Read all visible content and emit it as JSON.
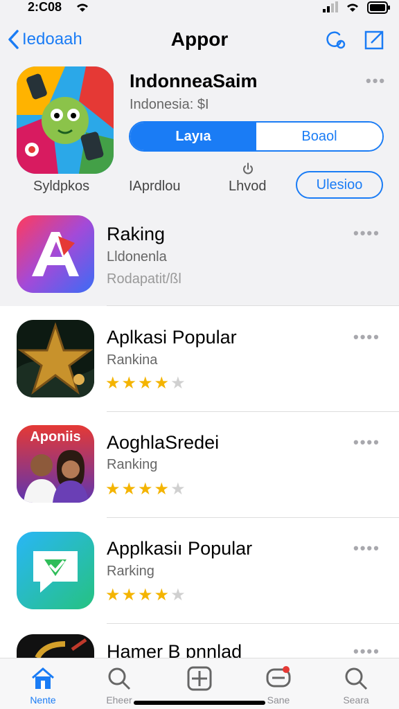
{
  "status": {
    "time": "2:C08"
  },
  "nav": {
    "back_label": "Iedoaah",
    "title": "Appor"
  },
  "featured": {
    "name": "IndonneaSaim",
    "subtitle": "Indonesia: $I",
    "seg_left": "Layıa",
    "seg_right": "Boaol",
    "meta": [
      "Syldpkos",
      "IAprdlou",
      "Lhvod"
    ],
    "update_label": "Ulesioo"
  },
  "apps": [
    {
      "name": "Raking",
      "sub": "Lldonenla",
      "sub2": "Rodapatit/ßl",
      "rating": null
    },
    {
      "name": "Aplkasi Popular",
      "sub": "Rankina",
      "rating": 4.5
    },
    {
      "name": "AoghlaSredei",
      "sub": "Ranking",
      "rating": 4.5,
      "icon_text": "Aponiis"
    },
    {
      "name": "Applkasiı Popular",
      "sub": "Rarking",
      "rating": 4.5
    },
    {
      "name": "Hamer B pnnlad",
      "sub": "",
      "rating": null
    }
  ],
  "tabs": [
    {
      "label": "Nente",
      "icon": "home-icon",
      "active": true
    },
    {
      "label": "Eheer",
      "icon": "search-icon"
    },
    {
      "label": "",
      "icon": "add-icon"
    },
    {
      "label": "Sane",
      "icon": "chat-icon"
    },
    {
      "label": "Seara",
      "icon": "search-icon"
    }
  ],
  "colors": {
    "accent": "#1a7cf5",
    "star": "#f4b400",
    "background_top": "#f2f2f4"
  }
}
